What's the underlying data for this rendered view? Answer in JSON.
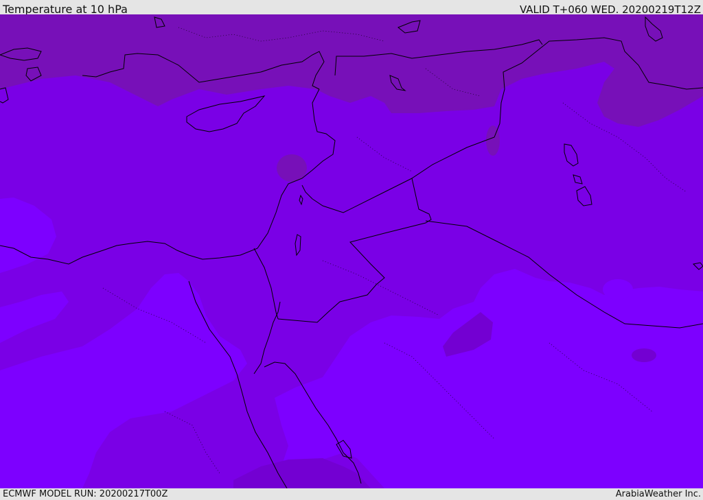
{
  "header": {
    "title": "Temperature at 10 hPa",
    "valid_time": "VALID T+060 WED. 20200219T12Z"
  },
  "footer": {
    "model_run": "ECMWF MODEL RUN: 20200217T00Z",
    "credit": "ArabiaWeather Inc."
  },
  "colors": {
    "band_cold": "#7300d2",
    "band_mid": "#7a00e6",
    "band_warm": "#7d00ff",
    "band_coldest": "#7710b8",
    "coastline": "#000000",
    "border": "#000000"
  }
}
